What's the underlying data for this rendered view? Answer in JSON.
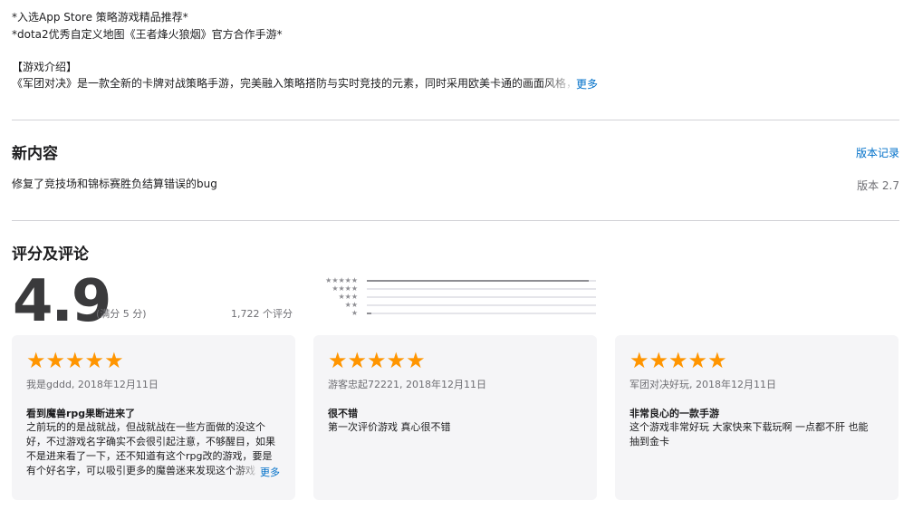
{
  "description": {
    "line1": "*入选App Store 策略游戏精品推荐*",
    "line2": "*dota2优秀自定义地图《王者烽火狼烟》官方合作手游*",
    "heading": "【游戏介绍】",
    "line3": "《军团对决》是一款全新的卡牌对战策略手游，完美融入策略搭防与实时竞技的元素，同时采用欧美卡通的画面风格，是一款",
    "more": "更多"
  },
  "whats_new": {
    "title": "新内容",
    "history_link": "版本记录",
    "notes": "修复了竞技场和锦标赛胜负结算错误的bug",
    "version": "版本 2.7"
  },
  "ratings": {
    "title": "评分及评论",
    "score": "4.9",
    "out_of": "(满分 5 分)",
    "count": "1,722 个评分",
    "histogram": [
      {
        "stars": "★★★★★",
        "fraction": 0.97
      },
      {
        "stars": "★★★★",
        "fraction": 0.0
      },
      {
        "stars": "★★★",
        "fraction": 0.0
      },
      {
        "stars": "★★",
        "fraction": 0.0
      },
      {
        "stars": "★",
        "fraction": 0.02
      }
    ],
    "star_color": "#ff9500"
  },
  "reviews": [
    {
      "stars": "★★★★★",
      "meta": "我是gddd, 2018年12月11日",
      "title": "看到魔兽rpg果断进来了",
      "body": [
        "之前玩的的是战就战，但战就战在一些方面做的没这个",
        "好，不过游戏名字确实不会很引起注意，不够醒目，如果",
        "不是进来看了一下，还不知道有这个rpg改的游戏，要是",
        "有个好名字，可以吸引更多的魔兽迷来发现这个游戏"
      ],
      "more": "更多"
    },
    {
      "stars": "★★★★★",
      "meta": "游客忠起72221, 2018年12月11日",
      "title": "很不错",
      "body": [
        "第一次评价游戏 真心很不错"
      ],
      "more": ""
    },
    {
      "stars": "★★★★★",
      "meta": "军团对决好玩, 2018年12月11日",
      "title": "非常良心的一款手游",
      "body": [
        "这个游戏非常好玩 大家快来下载玩啊 一点都不肝 也能",
        "抽到金卡"
      ],
      "more": ""
    }
  ]
}
